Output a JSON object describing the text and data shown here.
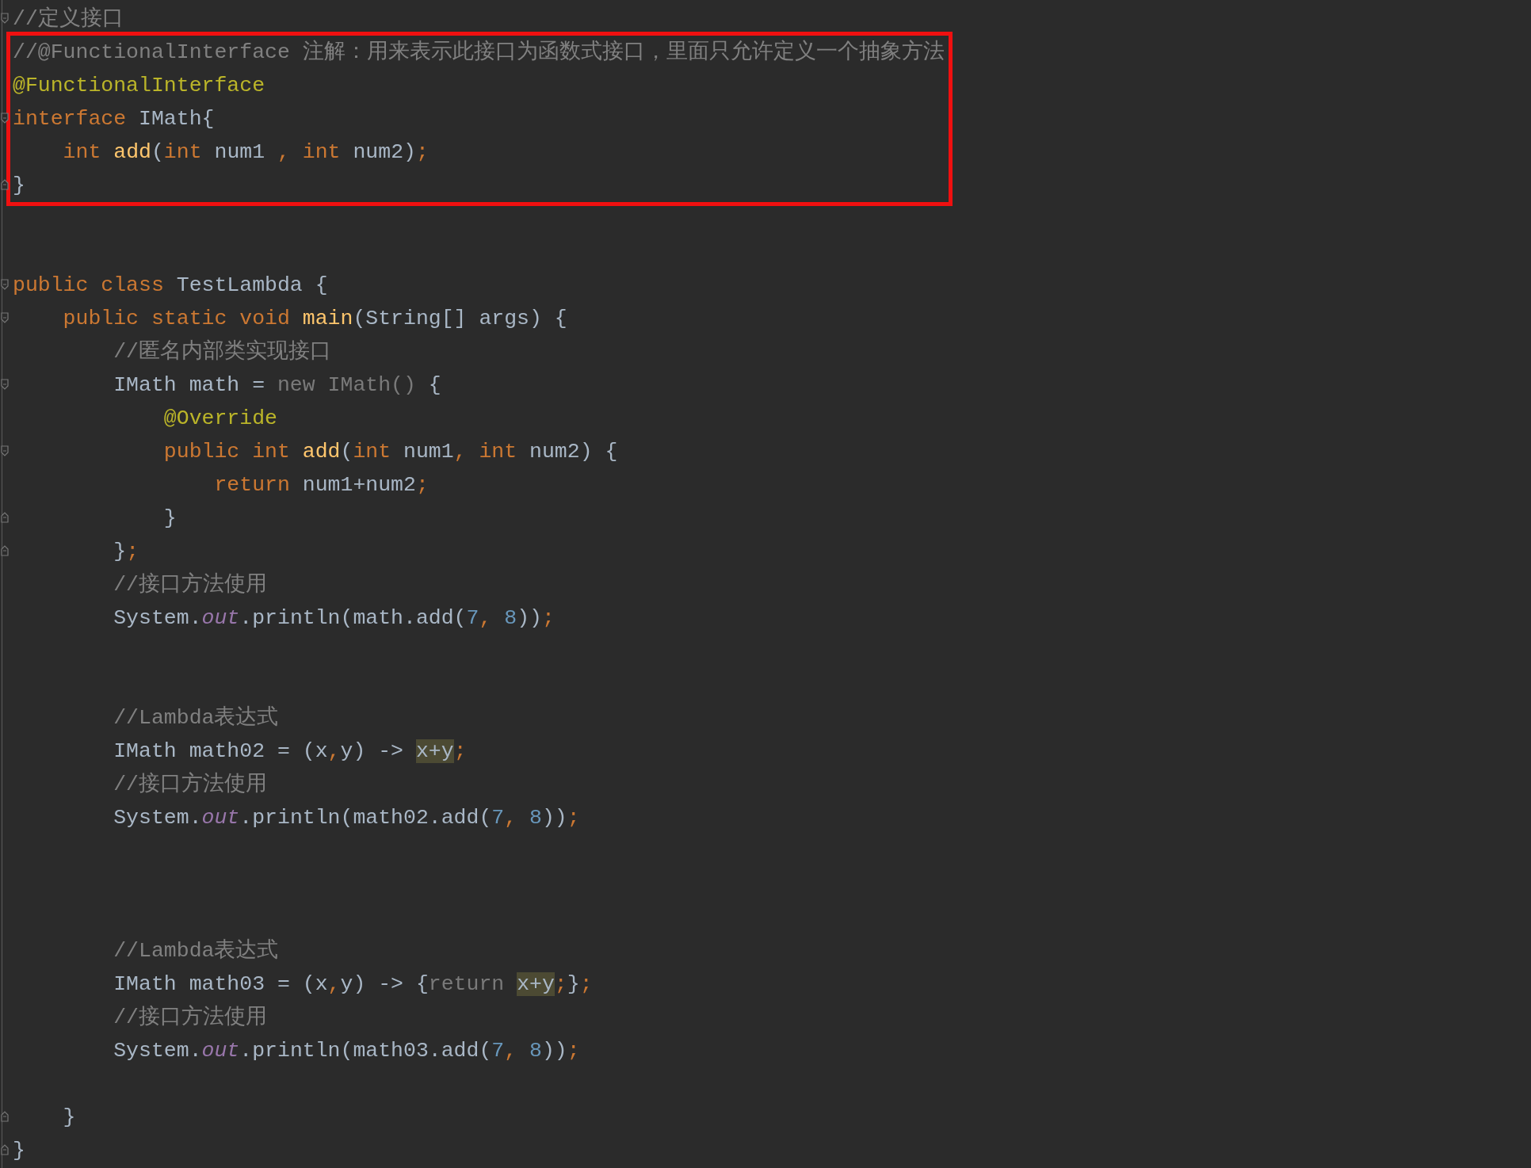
{
  "blocks": [
    {
      "boxed": false,
      "lines": [
        {
          "kind": "code",
          "fold_start": true,
          "fold_end": false,
          "tokens": [
            {
              "text": "//定义接口",
              "kind": "comment"
            }
          ]
        }
      ]
    },
    {
      "boxed": true,
      "lines": [
        {
          "kind": "code",
          "fold_start": false,
          "fold_end": false,
          "tokens": [
            {
              "text": "//@FunctionalInterface 注解：用来表示此接口为函数式接口，里面只允许定义一个抽象方法",
              "kind": "comment"
            }
          ]
        },
        {
          "kind": "code",
          "fold_start": false,
          "fold_end": false,
          "tokens": [
            {
              "text": "@FunctionalInterface",
              "kind": "annotation"
            }
          ]
        },
        {
          "kind": "code",
          "fold_start": true,
          "fold_end": false,
          "tokens": [
            {
              "text": "interface",
              "kind": "keyword"
            },
            {
              "text": " IMath{",
              "kind": "plain"
            }
          ]
        },
        {
          "kind": "code",
          "fold_start": false,
          "fold_end": false,
          "tokens": [
            {
              "text": "    int ",
              "kind": "keyword"
            },
            {
              "text": "add",
              "kind": "method"
            },
            {
              "text": "(",
              "kind": "plain"
            },
            {
              "text": "int ",
              "kind": "keyword"
            },
            {
              "text": "num1 ",
              "kind": "plain"
            },
            {
              "text": ", int ",
              "kind": "keyword"
            },
            {
              "text": "num2)",
              "kind": "plain"
            },
            {
              "text": ";",
              "kind": "keyword"
            }
          ]
        },
        {
          "kind": "code",
          "fold_start": false,
          "fold_end": true,
          "tokens": [
            {
              "text": "}",
              "kind": "plain"
            }
          ]
        }
      ]
    },
    {
      "boxed": false,
      "lines": [
        {
          "kind": "blank"
        },
        {
          "kind": "blank"
        },
        {
          "kind": "code",
          "fold_start": true,
          "fold_end": false,
          "tokens": [
            {
              "text": "public class ",
              "kind": "keyword"
            },
            {
              "text": "TestLambda {",
              "kind": "plain"
            }
          ]
        },
        {
          "kind": "code",
          "fold_start": true,
          "fold_end": false,
          "tokens": [
            {
              "text": "    public static void ",
              "kind": "keyword"
            },
            {
              "text": "main",
              "kind": "method"
            },
            {
              "text": "(String[] args) {",
              "kind": "plain"
            }
          ]
        },
        {
          "kind": "code",
          "fold_start": false,
          "fold_end": false,
          "tokens": [
            {
              "text": "        //匿名内部类实现接口",
              "kind": "comment"
            }
          ]
        },
        {
          "kind": "code",
          "fold_start": true,
          "fold_end": false,
          "tokens": [
            {
              "text": "        IMath math = ",
              "kind": "plain"
            },
            {
              "text": "new IMath()",
              "kind": "unused"
            },
            {
              "text": " {",
              "kind": "plain"
            }
          ]
        },
        {
          "kind": "code",
          "fold_start": false,
          "fold_end": false,
          "tokens": [
            {
              "text": "            @Override",
              "kind": "annotation"
            }
          ]
        },
        {
          "kind": "code",
          "fold_start": true,
          "fold_end": false,
          "tokens": [
            {
              "text": "            public int ",
              "kind": "keyword"
            },
            {
              "text": "add",
              "kind": "method"
            },
            {
              "text": "(",
              "kind": "plain"
            },
            {
              "text": "int ",
              "kind": "keyword"
            },
            {
              "text": "num1",
              "kind": "plain"
            },
            {
              "text": ", int ",
              "kind": "keyword"
            },
            {
              "text": "num2) {",
              "kind": "plain"
            }
          ]
        },
        {
          "kind": "code",
          "fold_start": false,
          "fold_end": false,
          "tokens": [
            {
              "text": "                return ",
              "kind": "keyword"
            },
            {
              "text": "num1+num2",
              "kind": "plain"
            },
            {
              "text": ";",
              "kind": "keyword"
            }
          ]
        },
        {
          "kind": "code",
          "fold_start": false,
          "fold_end": true,
          "tokens": [
            {
              "text": "            }",
              "kind": "plain"
            }
          ]
        },
        {
          "kind": "code",
          "fold_start": false,
          "fold_end": true,
          "tokens": [
            {
              "text": "        }",
              "kind": "plain"
            },
            {
              "text": ";",
              "kind": "keyword"
            }
          ]
        },
        {
          "kind": "code",
          "fold_start": false,
          "fold_end": false,
          "tokens": [
            {
              "text": "        //接口方法使用",
              "kind": "comment"
            }
          ]
        },
        {
          "kind": "code",
          "fold_start": false,
          "fold_end": false,
          "tokens": [
            {
              "text": "        System.",
              "kind": "plain"
            },
            {
              "text": "out",
              "kind": "field"
            },
            {
              "text": ".println(math.add(",
              "kind": "plain"
            },
            {
              "text": "7",
              "kind": "number"
            },
            {
              "text": ", ",
              "kind": "keyword"
            },
            {
              "text": "8",
              "kind": "number"
            },
            {
              "text": "))",
              "kind": "plain"
            },
            {
              "text": ";",
              "kind": "keyword"
            }
          ]
        },
        {
          "kind": "blank"
        },
        {
          "kind": "blank"
        },
        {
          "kind": "code",
          "fold_start": false,
          "fold_end": false,
          "tokens": [
            {
              "text": "        //Lambda表达式",
              "kind": "comment"
            }
          ]
        },
        {
          "kind": "code",
          "fold_start": false,
          "fold_end": false,
          "tokens": [
            {
              "text": "        IMath math02 = (x",
              "kind": "plain"
            },
            {
              "text": ",",
              "kind": "keyword"
            },
            {
              "text": "y) -> ",
              "kind": "plain"
            },
            {
              "text": "x+y",
              "kind": "highlight"
            },
            {
              "text": ";",
              "kind": "keyword"
            }
          ]
        },
        {
          "kind": "code",
          "fold_start": false,
          "fold_end": false,
          "tokens": [
            {
              "text": "        //接口方法使用",
              "kind": "comment"
            }
          ]
        },
        {
          "kind": "code",
          "fold_start": false,
          "fold_end": false,
          "tokens": [
            {
              "text": "        System.",
              "kind": "plain"
            },
            {
              "text": "out",
              "kind": "field"
            },
            {
              "text": ".println(math02.add(",
              "kind": "plain"
            },
            {
              "text": "7",
              "kind": "number"
            },
            {
              "text": ", ",
              "kind": "keyword"
            },
            {
              "text": "8",
              "kind": "number"
            },
            {
              "text": "))",
              "kind": "plain"
            },
            {
              "text": ";",
              "kind": "keyword"
            }
          ]
        },
        {
          "kind": "blank"
        },
        {
          "kind": "blank"
        },
        {
          "kind": "blank"
        },
        {
          "kind": "code",
          "fold_start": false,
          "fold_end": false,
          "tokens": [
            {
              "text": "        //Lambda表达式",
              "kind": "comment"
            }
          ]
        },
        {
          "kind": "code",
          "fold_start": false,
          "fold_end": false,
          "tokens": [
            {
              "text": "        IMath math03 = (x",
              "kind": "plain"
            },
            {
              "text": ",",
              "kind": "keyword"
            },
            {
              "text": "y) -> {",
              "kind": "plain"
            },
            {
              "text": "return ",
              "kind": "unused"
            },
            {
              "text": "x+y",
              "kind": "highlight"
            },
            {
              "text": ";",
              "kind": "keyword"
            },
            {
              "text": "}",
              "kind": "plain"
            },
            {
              "text": ";",
              "kind": "keyword"
            }
          ]
        },
        {
          "kind": "code",
          "fold_start": false,
          "fold_end": false,
          "tokens": [
            {
              "text": "        //接口方法使用",
              "kind": "comment"
            }
          ]
        },
        {
          "kind": "code",
          "fold_start": false,
          "fold_end": false,
          "tokens": [
            {
              "text": "        System.",
              "kind": "plain"
            },
            {
              "text": "out",
              "kind": "field"
            },
            {
              "text": ".println(math03.add(",
              "kind": "plain"
            },
            {
              "text": "7",
              "kind": "number"
            },
            {
              "text": ", ",
              "kind": "keyword"
            },
            {
              "text": "8",
              "kind": "number"
            },
            {
              "text": "))",
              "kind": "plain"
            },
            {
              "text": ";",
              "kind": "keyword"
            }
          ]
        },
        {
          "kind": "blank"
        },
        {
          "kind": "code",
          "fold_start": false,
          "fold_end": true,
          "tokens": [
            {
              "text": "    }",
              "kind": "plain"
            }
          ]
        },
        {
          "kind": "code",
          "fold_start": false,
          "fold_end": true,
          "tokens": [
            {
              "text": "}",
              "kind": "plain"
            }
          ]
        }
      ]
    }
  ]
}
